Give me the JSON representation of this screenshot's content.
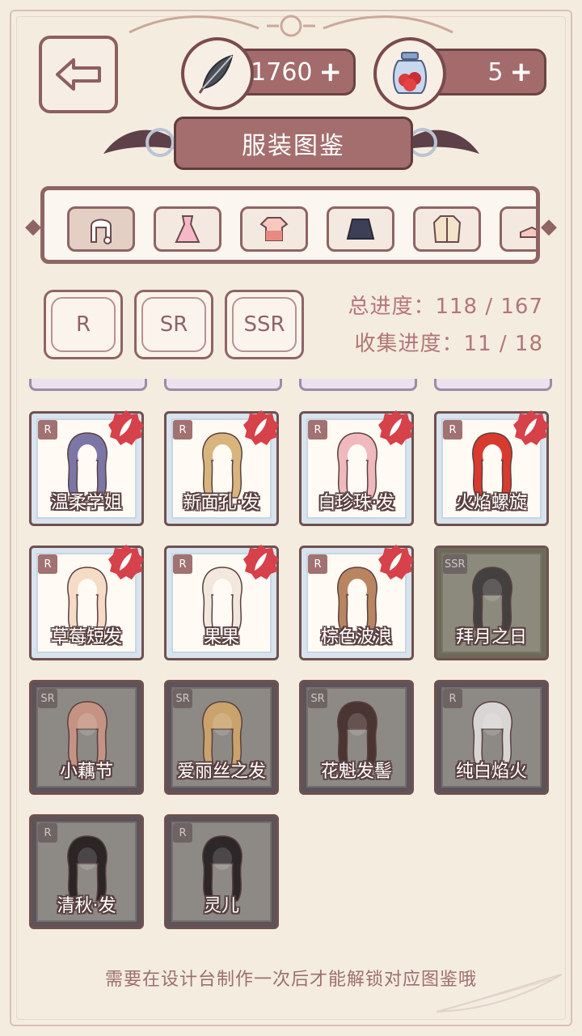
{
  "header": {
    "feathers": "1760",
    "berries": "5",
    "plus_symbol": "+",
    "title": "服装图鉴"
  },
  "categories": [
    {
      "icon": "wig-icon",
      "active": true
    },
    {
      "icon": "dress-icon",
      "active": false
    },
    {
      "icon": "top-icon",
      "active": false
    },
    {
      "icon": "skirt-icon",
      "active": false
    },
    {
      "icon": "jacket-icon",
      "active": false
    },
    {
      "icon": "shoe-icon",
      "active": false
    }
  ],
  "rarity_filters": [
    "R",
    "SR",
    "SSR"
  ],
  "progress": {
    "total": "总进度：118 / 167",
    "collect": "收集进度：11 / 18"
  },
  "items": [
    {
      "name": "温柔学姐",
      "rarity": "R",
      "state": "owned",
      "hair_color": "#7c76a6"
    },
    {
      "name": "新面孔·发",
      "rarity": "R",
      "state": "owned",
      "hair_color": "#d9b57e"
    },
    {
      "name": "白珍珠·发",
      "rarity": "R",
      "state": "owned",
      "hair_color": "#f0b9bd"
    },
    {
      "name": "火焰螺旋",
      "rarity": "R",
      "state": "owned",
      "hair_color": "#d83a2e"
    },
    {
      "name": "草莓短发",
      "rarity": "R",
      "state": "owned",
      "hair_color": "#f4dcc6"
    },
    {
      "name": "果果",
      "rarity": "R",
      "state": "owned",
      "hair_color": "#f2e8dd"
    },
    {
      "name": "棕色波浪",
      "rarity": "R",
      "state": "owned",
      "hair_color": "#b98560"
    },
    {
      "name": "拜月之日",
      "rarity": "SSR",
      "state": "dark",
      "hair_color": "#444040"
    },
    {
      "name": "小藕节",
      "rarity": "SR",
      "state": "locked",
      "hair_color": "#c49383"
    },
    {
      "name": "爱丽丝之发",
      "rarity": "SR",
      "state": "locked",
      "hair_color": "#c9a36b"
    },
    {
      "name": "花魁发髻",
      "rarity": "SR",
      "state": "locked",
      "hair_color": "#4b3533"
    },
    {
      "name": "纯白焰火",
      "rarity": "R",
      "state": "locked",
      "hair_color": "#d8d6d4"
    },
    {
      "name": "清秋·发",
      "rarity": "R",
      "state": "locked",
      "hair_color": "#2b2526"
    },
    {
      "name": "灵儿",
      "rarity": "R",
      "state": "locked",
      "hair_color": "#2d2729"
    }
  ],
  "footer": "需要在设计台制作一次后才能解锁对应图鉴哦",
  "colors": {
    "accent": "#a36b6b",
    "border": "#8f6464",
    "background": "#f5ece0"
  }
}
